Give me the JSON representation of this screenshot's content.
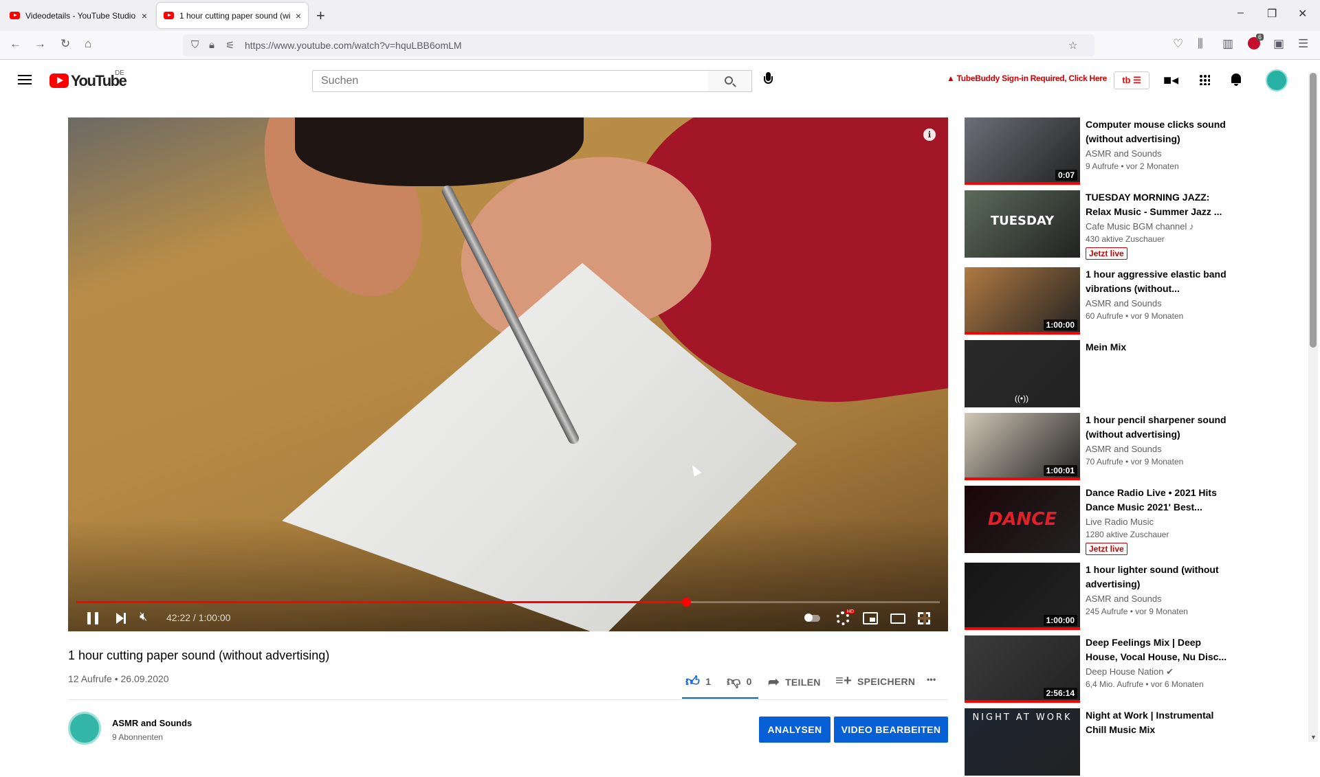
{
  "browser": {
    "tabs": [
      {
        "label": "Videodetails - YouTube Studio",
        "close": "×"
      },
      {
        "label": "1 hour cutting paper sound (wi",
        "close": "×"
      }
    ],
    "new_tab": "+",
    "window_controls": {
      "minimize": "–",
      "restore": "❐",
      "close": "✕"
    },
    "nav": {
      "back": "←",
      "forward": "→",
      "reload": "↻",
      "home": "⌂"
    },
    "url": "https://www.youtube.com/watch?v=hquLBB6omLM",
    "abp_badge": "6"
  },
  "masthead": {
    "logo_text": "YouTube",
    "country": "DE",
    "search_placeholder": "Suchen",
    "tubebuddy_warning": "TubeBuddy Sign-in Required, Click Here",
    "tubebuddy_button": "tb ☰",
    "icons": [
      "hamburger-menu-icon",
      "search-icon",
      "microphone-icon",
      "create-video-icon",
      "apps-icon",
      "notifications-icon",
      "account-avatar"
    ]
  },
  "player": {
    "time": "42:22 / 1:00:00",
    "info": "i",
    "progress": 0.706
  },
  "video": {
    "title": "1 hour cutting paper sound (without advertising)",
    "meta": "12 Aufrufe • 26.09.2020",
    "likes": "1",
    "dislikes": "0",
    "share": "TEILEN",
    "save": "SPEICHERN",
    "more": "•••"
  },
  "channel": {
    "name": "ASMR and Sounds",
    "subscribers": "9 Abonnenten",
    "analytics_button": "ANALYSEN",
    "edit_button": "VIDEO BEARBEITEN"
  },
  "sidebar": {
    "items": [
      {
        "title": "Computer mouse clicks sound (without advertising)",
        "channel": "ASMR and Sounds",
        "views": "9 Aufrufe • vor 2 Monaten",
        "duration": "0:07",
        "thumb_color": "#6c6f78"
      },
      {
        "title": "TUESDAY MORNING JAZZ: Relax Music - Summer Jazz ...",
        "channel": "Cafe Music BGM channel ♪",
        "views": "430 aktive Zuschauer",
        "badge": "Jetzt live",
        "thumb_color": "#5b6b5a",
        "thumb_text": "TUESDAY"
      },
      {
        "title": "1 hour aggressive elastic band vibrations (without...",
        "channel": "ASMR and Sounds",
        "views": "60 Aufrufe • vor 9 Monaten",
        "duration": "1:00:00",
        "thumb_color": "#b07a42"
      },
      {
        "title": "Mein Mix",
        "thumb_color": "#2a2a2a"
      },
      {
        "title": "1 hour pencil sharpener sound (without advertising)",
        "channel": "ASMR and Sounds",
        "views": "70 Aufrufe • vor 9 Monaten",
        "duration": "1:00:01",
        "thumb_color": "#cfc6b5"
      },
      {
        "title": "Dance Radio Live • 2021 Hits Dance Music 2021' Best...",
        "channel": "Live Radio Music",
        "views": "1280 aktive Zuschauer",
        "badge": "Jetzt live",
        "thumb_color": "#1a0508",
        "thumb_text": "DANCE"
      },
      {
        "title": "1 hour lighter sound (without advertising)",
        "channel": "ASMR and Sounds",
        "views": "245 Aufrufe • vor 9 Monaten",
        "duration": "1:00:00",
        "thumb_color": "#161616"
      },
      {
        "title": "Deep Feelings Mix | Deep House, Vocal House, Nu Disc...",
        "channel": "Deep House Nation ✔",
        "views": "6,4 Mio. Aufrufe • vor 6 Monaten",
        "duration": "2:56:14",
        "thumb_color": "#3b3b3b"
      },
      {
        "title": "Night at Work | Instrumental Chill Music Mix",
        "thumb_color": "#1d2633",
        "thumb_text": "NIGHT AT WORK"
      }
    ]
  }
}
